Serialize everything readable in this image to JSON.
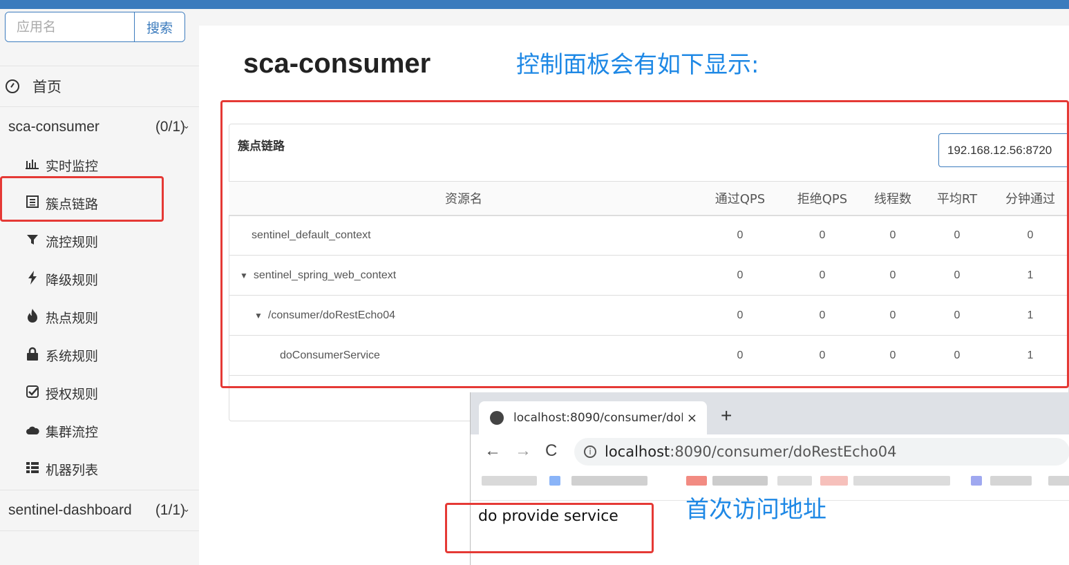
{
  "search": {
    "placeholder": "应用名",
    "button_label": "搜索"
  },
  "sidebar": {
    "home_label": "首页",
    "apps": [
      {
        "name": "sca-consumer",
        "count": "(0/1)"
      },
      {
        "name": "sentinel-dashboard",
        "count": "(1/1)"
      }
    ],
    "menu": [
      {
        "icon": "bar-chart-icon",
        "label": "实时监控"
      },
      {
        "icon": "list-icon",
        "label": "簇点链路"
      },
      {
        "icon": "filter-icon",
        "label": "流控规则"
      },
      {
        "icon": "bolt-icon",
        "label": "降级规则"
      },
      {
        "icon": "fire-icon",
        "label": "热点规则"
      },
      {
        "icon": "lock-icon",
        "label": "系统规则"
      },
      {
        "icon": "check-square-icon",
        "label": "授权规则"
      },
      {
        "icon": "cloud-icon",
        "label": "集群流控"
      },
      {
        "icon": "th-list-icon",
        "label": "机器列表"
      }
    ]
  },
  "main": {
    "app_title": "sca-consumer",
    "annotation_top": "控制面板会有如下显示:",
    "annotation_bottom": "首次访问地址",
    "panel_title": "簇点链路",
    "machine": "192.168.12.56:8720",
    "table": {
      "headers": [
        "资源名",
        "通过QPS",
        "拒绝QPS",
        "线程数",
        "平均RT",
        "分钟通过"
      ],
      "rows": [
        {
          "name": "sentinel_default_context",
          "toggle": "",
          "values": [
            "0",
            "0",
            "0",
            "0",
            "0"
          ]
        },
        {
          "name": "sentinel_spring_web_context",
          "toggle": "▼",
          "values": [
            "0",
            "0",
            "0",
            "0",
            "1"
          ]
        },
        {
          "name": "/consumer/doRestEcho04",
          "toggle": "▼",
          "values": [
            "0",
            "0",
            "0",
            "0",
            "1"
          ]
        },
        {
          "name": "doConsumerService",
          "toggle": "",
          "values": [
            "0",
            "0",
            "0",
            "0",
            "1"
          ]
        }
      ]
    }
  },
  "browser": {
    "tab_title": "localhost:8090/consumer/doR",
    "close_glyph": "×",
    "new_tab_glyph": "+",
    "back_glyph": "←",
    "forward_glyph": "→",
    "reload_glyph": "C",
    "url_host": "localhost",
    "url_path": ":8090/consumer/doRestEcho04",
    "page_text": "do provide service"
  },
  "colors": {
    "accent": "#3b7bbd",
    "highlight": "#e53935",
    "annotation": "#1e88e5"
  }
}
